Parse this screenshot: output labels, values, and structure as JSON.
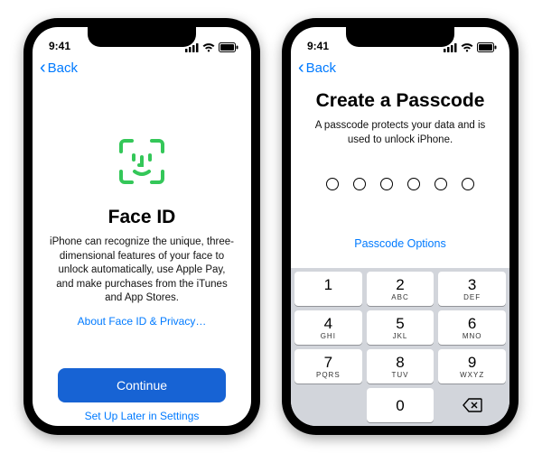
{
  "status": {
    "time": "9:41"
  },
  "nav": {
    "back": "Back"
  },
  "faceid": {
    "title": "Face ID",
    "desc": "iPhone can recognize the unique, three-dimensional features of your face to unlock automatically, use Apple Pay, and make purchases from the iTunes and App Stores.",
    "privacy_link": "About Face ID & Privacy…",
    "continue": "Continue",
    "later": "Set Up Later in Settings"
  },
  "passcode": {
    "title": "Create a Passcode",
    "desc": "A passcode protects your data and is used to unlock iPhone.",
    "options": "Passcode Options",
    "dots": 6
  },
  "keypad": {
    "keys": [
      {
        "n": "1",
        "l": ""
      },
      {
        "n": "2",
        "l": "ABC"
      },
      {
        "n": "3",
        "l": "DEF"
      },
      {
        "n": "4",
        "l": "GHI"
      },
      {
        "n": "5",
        "l": "JKL"
      },
      {
        "n": "6",
        "l": "MNO"
      },
      {
        "n": "7",
        "l": "PQRS"
      },
      {
        "n": "8",
        "l": "TUV"
      },
      {
        "n": "9",
        "l": "WXYZ"
      },
      {
        "n": "0",
        "l": ""
      }
    ]
  }
}
